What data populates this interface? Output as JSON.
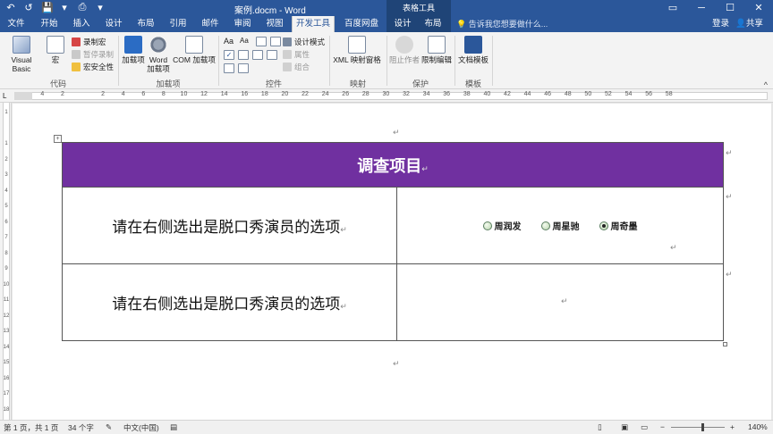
{
  "titlebar": {
    "title": "案例.docm - Word",
    "context_group": "表格工具",
    "qat": [
      "↶",
      "↺",
      "💾",
      "▾",
      "⎙",
      "▾"
    ],
    "window_controls": [
      "▭",
      "─",
      "☐",
      "✕"
    ]
  },
  "tabs": {
    "items": [
      "文件",
      "开始",
      "插入",
      "设计",
      "布局",
      "引用",
      "邮件",
      "审阅",
      "视图",
      "开发工具",
      "百度网盘",
      "设计",
      "布局"
    ],
    "active": "开发工具",
    "tell_me": "告诉我您想要做什么...",
    "login": "登录",
    "share": "共享"
  },
  "ribbon": {
    "code": {
      "label": "代码",
      "visual_basic": "Visual Basic",
      "macros": "宏",
      "record_macro": "录制宏",
      "pause_recording": "暂停录制",
      "macro_security": "宏安全性"
    },
    "addins": {
      "label": "加载项",
      "addins": "加载项",
      "word_addins": "Word 加载项",
      "com_addins": "COM 加载项"
    },
    "controls": {
      "label": "控件",
      "design_mode": "设计模式",
      "properties": "属性",
      "group": "组合"
    },
    "mapping": {
      "label": "映射",
      "xml_mapping": "XML 映射窗格"
    },
    "protect": {
      "label": "保护",
      "block_authors": "阻止作者",
      "restrict_editing": "限制编辑"
    },
    "templates": {
      "label": "模板",
      "document_template": "文档模板"
    }
  },
  "ruler": {
    "numbers": [
      "4",
      "2",
      "",
      "2",
      "4",
      "6",
      "8",
      "10",
      "12",
      "14",
      "16",
      "18",
      "20",
      "22",
      "24",
      "26",
      "28",
      "30",
      "32",
      "34",
      "36",
      "38",
      "40",
      "42",
      "44",
      "46",
      "48",
      "50",
      "52",
      "54",
      "56",
      "58"
    ]
  },
  "document": {
    "table": {
      "header": "调查项目",
      "rows": [
        {
          "question": "请在右侧选出是脱口秀演员的选项",
          "options": [
            {
              "label": "周润发",
              "checked": false
            },
            {
              "label": "周星驰",
              "checked": false
            },
            {
              "label": "周奇墨",
              "checked": true
            }
          ]
        },
        {
          "question": "请在右侧选出是脱口秀演员的选项",
          "options": []
        }
      ]
    }
  },
  "status": {
    "page": "第 1 页，共 1 页",
    "words": "34 个字",
    "language": "中文(中国)",
    "zoom": "140%"
  },
  "colors": {
    "title_bar": "#2b579a",
    "table_header": "#7030a0"
  }
}
